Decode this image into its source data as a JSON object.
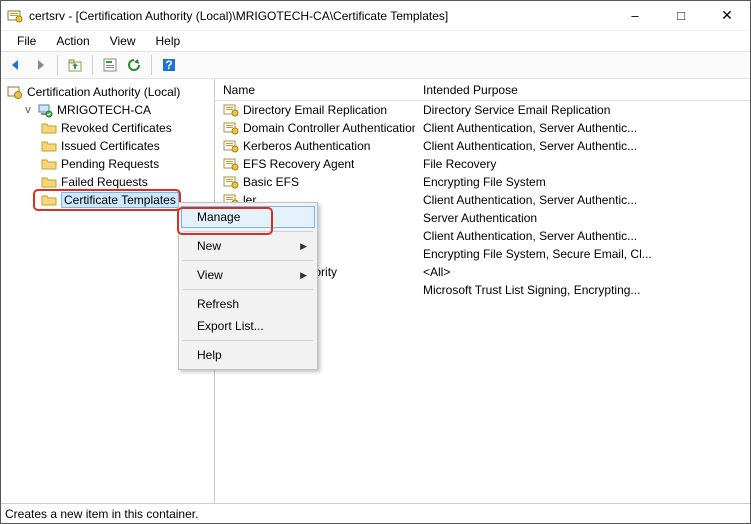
{
  "window": {
    "title": "certsrv - [Certification Authority (Local)\\MRIGOTECH-CA\\Certificate Templates]"
  },
  "menus": {
    "file": "File",
    "action": "Action",
    "view": "View",
    "help": "Help"
  },
  "tree": {
    "root": "Certification Authority (Local)",
    "ca": "MRIGOTECH-CA",
    "items": {
      "revoked": "Revoked Certificates",
      "issued": "Issued Certificates",
      "pending": "Pending Requests",
      "failed": "Failed Requests",
      "templates": "Certificate Templates"
    }
  },
  "list_headers": {
    "name": "Name",
    "purpose": "Intended Purpose"
  },
  "rows": [
    {
      "name": "Directory Email Replication",
      "purpose": "Directory Service Email Replication"
    },
    {
      "name": "Domain Controller Authentication",
      "purpose": "Client Authentication, Server Authentic..."
    },
    {
      "name": "Kerberos Authentication",
      "purpose": "Client Authentication, Server Authentic..."
    },
    {
      "name": "EFS Recovery Agent",
      "purpose": "File Recovery"
    },
    {
      "name": "Basic EFS",
      "purpose": "Encrypting File System"
    },
    {
      "name": "ler",
      "purpose": "Client Authentication, Server Authentic..."
    },
    {
      "name": "",
      "purpose": "Server Authentication"
    },
    {
      "name": "",
      "purpose": "Client Authentication, Server Authentic..."
    },
    {
      "name": "",
      "purpose": "Encrypting File System, Secure Email, Cl..."
    },
    {
      "name": "tification Authority",
      "purpose": "<All>"
    },
    {
      "name": "",
      "purpose": "Microsoft Trust List Signing, Encrypting..."
    }
  ],
  "context_menu": {
    "manage": "Manage",
    "new": "New",
    "view": "View",
    "refresh": "Refresh",
    "export": "Export List...",
    "help": "Help"
  },
  "status": "Creates a new item in this container."
}
